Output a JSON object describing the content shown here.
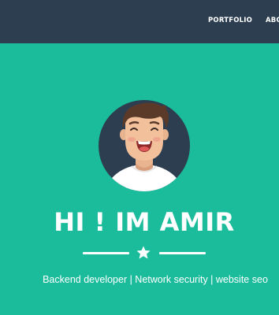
{
  "nav": {
    "links": [
      {
        "label": "PORTFOLIO"
      },
      {
        "label": "ABOUT"
      }
    ]
  },
  "masthead": {
    "avatar_icon": "user-avatar-icon",
    "title": "HI ! IM AMIR",
    "divider_icon": "star-icon",
    "subtitle": "Backend developer | Network security | website seo"
  },
  "colors": {
    "nav_background": "#2c3e50",
    "masthead_background": "#1abc9c",
    "text": "#ffffff"
  }
}
